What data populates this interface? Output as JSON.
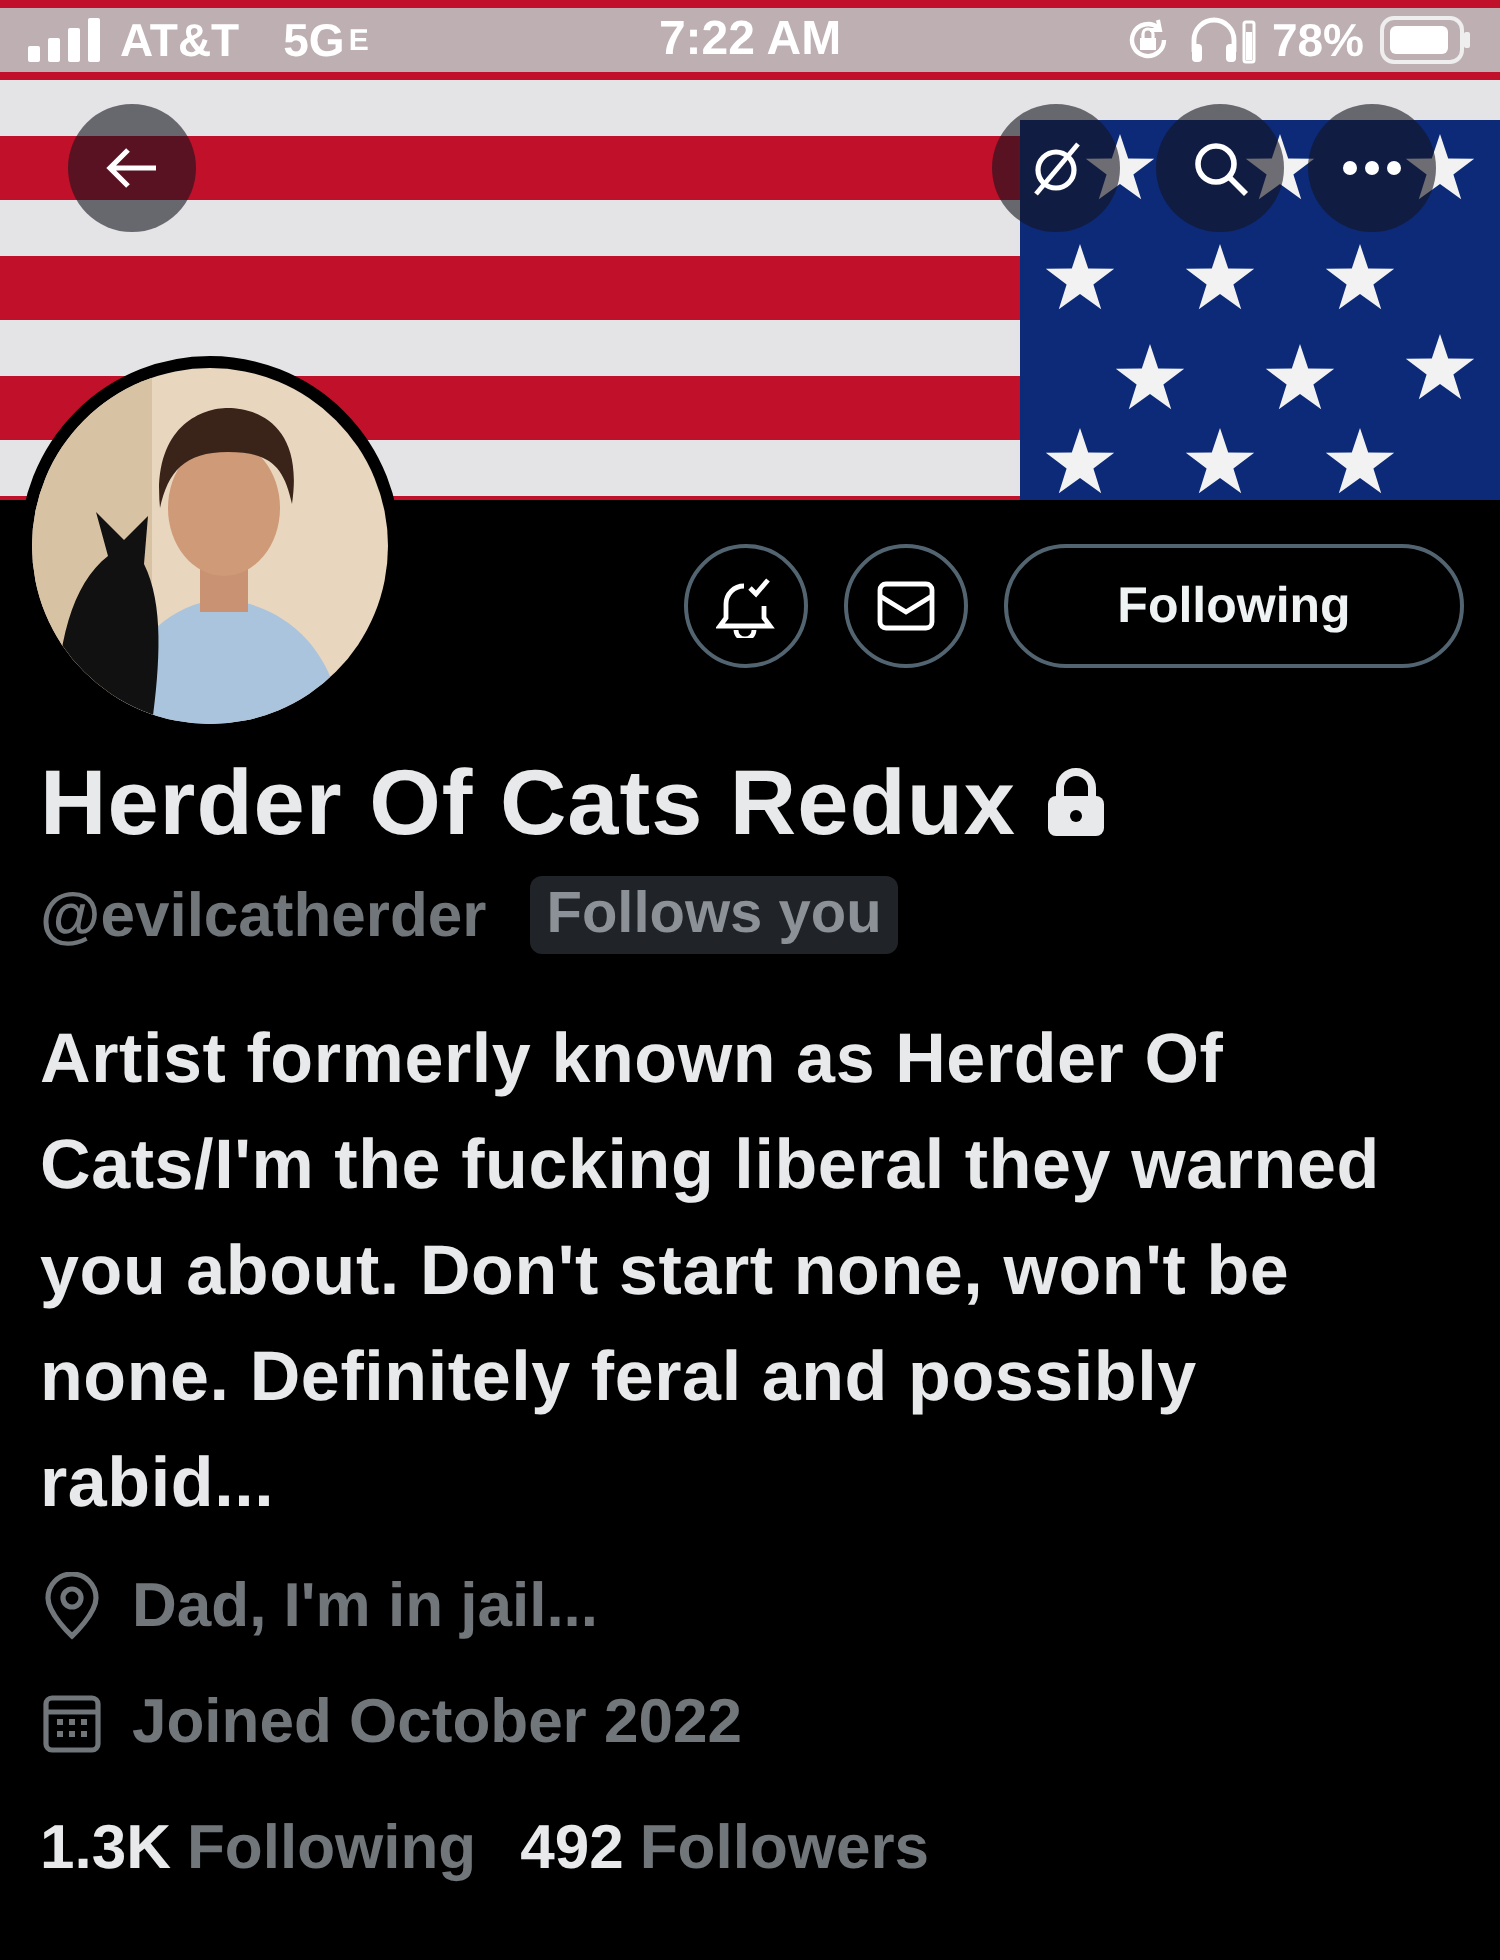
{
  "status_bar": {
    "carrier": "AT&T",
    "network": "5G",
    "network_suffix": "E",
    "time": "7:22 AM",
    "battery": "78%"
  },
  "profile": {
    "name": "Herder Of Cats Redux",
    "protected": true,
    "handle": "@evilcatherder",
    "follows_you": "Follows you",
    "follow_button": "Following",
    "bio": "Artist formerly known as Herder Of Cats/I'm the fucking liberal they warned you about. Don't start none, won't be none. Definitely feral and possibly rabid...",
    "location": "Dad, I'm in jail...",
    "joined": "Joined October 2022",
    "stats": [
      {
        "count": "1.3K",
        "label": "Following"
      },
      {
        "count": "492",
        "label": "Followers"
      }
    ]
  }
}
